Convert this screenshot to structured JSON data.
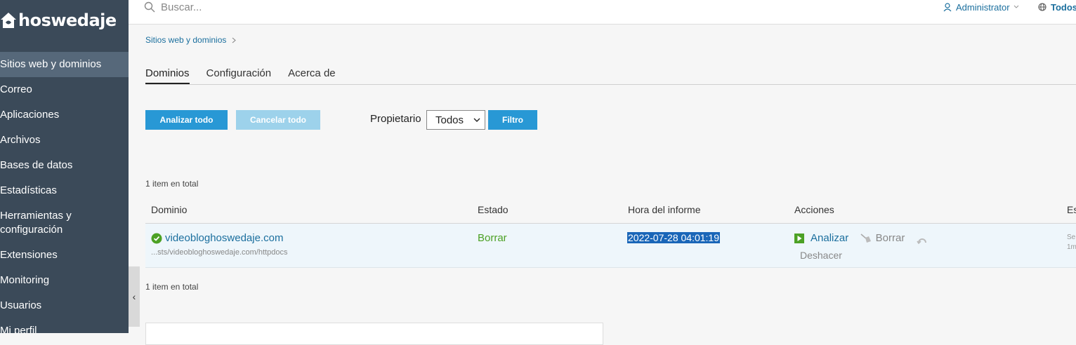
{
  "brand": {
    "name": "hoswedaje"
  },
  "sidebar": {
    "items": [
      {
        "label": "Sitios web y dominios"
      },
      {
        "label": "Correo"
      },
      {
        "label": "Aplicaciones"
      },
      {
        "label": "Archivos"
      },
      {
        "label": "Bases de datos"
      },
      {
        "label": "Estadísticas"
      },
      {
        "label": "Herramientas y configuración"
      },
      {
        "label": "Extensiones"
      },
      {
        "label": "Monitoring"
      },
      {
        "label": "Usuarios"
      },
      {
        "label": "Mi perfil"
      }
    ],
    "collapse_icon": "‹"
  },
  "topbar": {
    "search_placeholder": "Buscar...",
    "user": "Administrator",
    "subscriptions": "Todos"
  },
  "breadcrumb": {
    "item": "Sitios web y dominios"
  },
  "tabs": [
    {
      "label": "Dominios"
    },
    {
      "label": "Configuración"
    },
    {
      "label": "Acerca de"
    }
  ],
  "toolbar": {
    "analyze_all": "Analizar todo",
    "cancel_all": "Cancelar todo",
    "owner_label": "Propietario",
    "owner_value": "Todos",
    "filter": "Filtro"
  },
  "list": {
    "count_top": "1 item en total",
    "count_bottom": "1 item en total",
    "columns": [
      "Dominio",
      "Estado",
      "Hora del informe",
      "Acciones",
      "Es"
    ],
    "rows": [
      {
        "domain": "videobloghoswedaje.com",
        "path": "...sts/videobloghoswedaje.com/httpdocs",
        "status": "Borrar",
        "report_time": "2022-07-28 04:01:19",
        "action_analyze": "Analizar",
        "action_delete": "Borrar",
        "action_undo": "Deshacer",
        "extra_line1": "Se",
        "extra_line2": "1m"
      }
    ]
  },
  "colors": {
    "sidebar_bg": "#3b4a59",
    "accent": "#2898d5",
    "link": "#1b6f9e",
    "success": "#4ca125"
  }
}
